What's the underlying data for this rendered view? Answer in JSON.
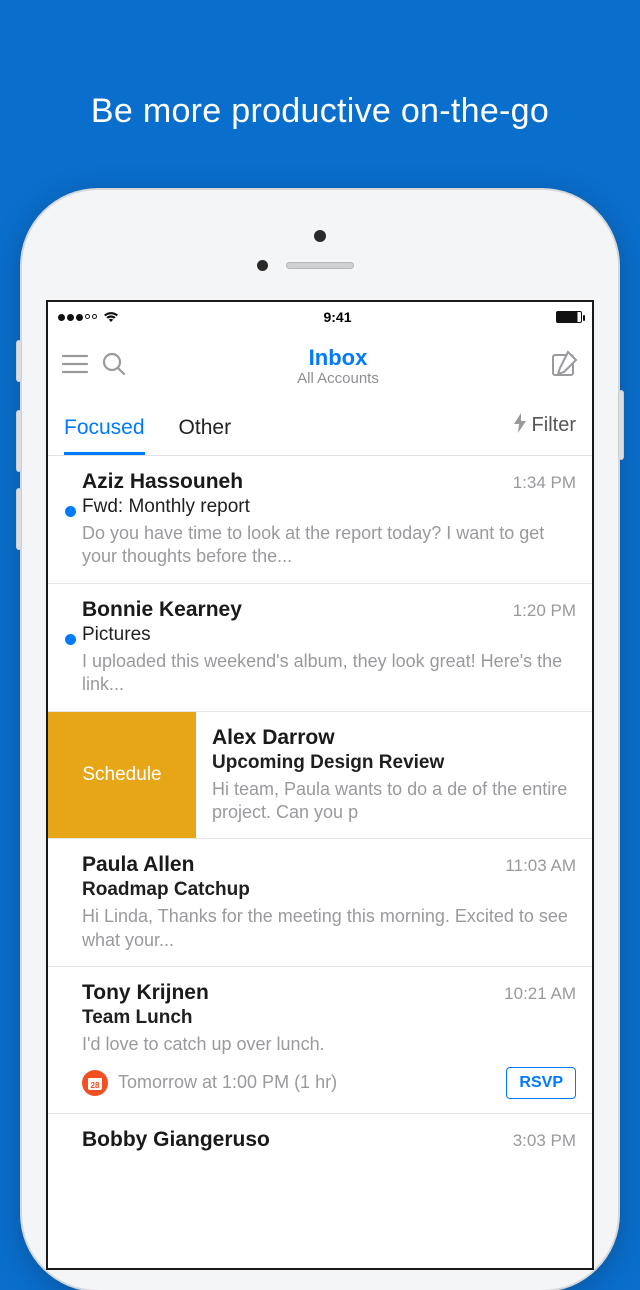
{
  "tagline": "Be more productive on-the-go",
  "status": {
    "time": "9:41"
  },
  "header": {
    "title": "Inbox",
    "subtitle": "All Accounts"
  },
  "tabs": {
    "focused": "Focused",
    "other": "Other",
    "filter": "Filter"
  },
  "emails": [
    {
      "sender": "Aziz Hassouneh",
      "time": "1:34 PM",
      "subject": "Fwd: Monthly report",
      "preview": "Do you have time to look at the report today? I want to get your thoughts before the..."
    },
    {
      "sender": "Bonnie Kearney",
      "time": "1:20 PM",
      "subject": "Pictures",
      "preview": "I uploaded this weekend's album, they look great! Here's the link..."
    },
    {
      "sender": "Alex Darrow",
      "subject": "Upcoming Design Review",
      "preview": "Hi team, Paula wants to do a de of the entire project. Can you p"
    },
    {
      "sender": "Paula Allen",
      "time": "11:03 AM",
      "subject": "Roadmap Catchup",
      "preview": "Hi Linda, Thanks for the meeting this morning. Excited to see what your..."
    },
    {
      "sender": "Tony Krijnen",
      "time": "10:21 AM",
      "subject": "Team Lunch",
      "preview": "I'd love to catch up over lunch.",
      "event_text": "Tomorrow at 1:00 PM (1 hr)",
      "rsvp_label": "RSVP"
    },
    {
      "sender": "Bobby Giangeruso",
      "time": "3:03 PM"
    }
  ],
  "swipe_action": "Schedule",
  "calendar_badge": "28"
}
